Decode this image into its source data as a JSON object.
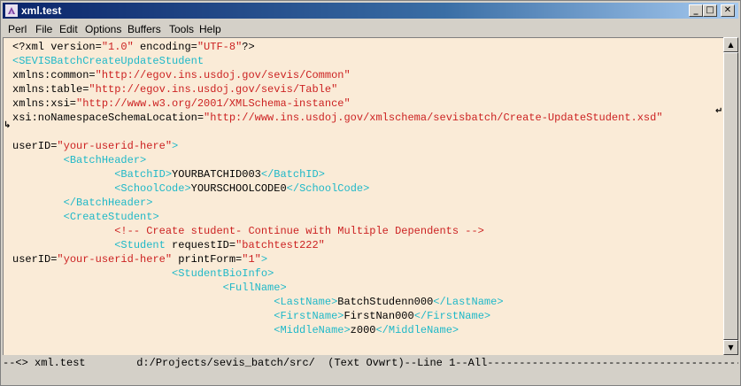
{
  "window": {
    "title": "xml.test",
    "minimize_glyph": "_",
    "maximize_glyph": "□",
    "close_glyph": "✕"
  },
  "menu": [
    "Perl",
    "File",
    "Edit",
    "Options",
    "Buffers",
    "Tools",
    "Help"
  ],
  "editor": {
    "background": "#faebd7",
    "tag_color": "#1fb8c8",
    "string_color": "#cc2222",
    "lines": [
      [
        "<?xml version=",
        "\"1.0\"",
        " encoding=",
        "\"UTF-8\"",
        "?>"
      ],
      [
        "<SEVISBatchCreateUpdateStudent"
      ],
      [
        "xmlns:common=",
        "\"http://egov.ins.usdoj.gov/sevis/Common\""
      ],
      [
        "xmlns:table=",
        "\"http://egov.ins.usdoj.gov/sevis/Table\""
      ],
      [
        "xmlns:xsi=",
        "\"http://www.w3.org/2001/XMLSchema-instance\""
      ],
      [
        "xsi:noNamespaceSchemaLocation=",
        "\"http://www.ins.usdoj.gov/xmlschema/sevisbatch/Create-UpdateStudent.xsd\""
      ],
      [
        ""
      ],
      [
        "userID=",
        "\"your-userid-here\"",
        ">"
      ],
      [
        "        ",
        "<",
        "BatchHeader",
        ">"
      ],
      [
        "                ",
        "<",
        "BatchID",
        ">",
        "YOURBATCHID003",
        "</",
        "BatchID",
        ">"
      ],
      [
        "                ",
        "<",
        "SchoolCode",
        ">",
        "YOURSCHOOLCODE0",
        "</",
        "SchoolCode",
        ">"
      ],
      [
        "        ",
        "</",
        "BatchHeader",
        ">"
      ],
      [
        "        ",
        "<",
        "CreateStudent",
        ">"
      ],
      [
        "                ",
        "<!-- Create student- Continue with Multiple Dependents -->"
      ],
      [
        "                ",
        "<",
        "Student",
        " requestID=",
        "\"batchtest222\""
      ],
      [
        "userID=",
        "\"your-userid-here\"",
        " printForm=",
        "\"1\"",
        ">"
      ],
      [
        "                         ",
        "<",
        "StudentBioInfo",
        ">"
      ],
      [
        "                                 ",
        "<",
        "FullName",
        ">"
      ],
      [
        "                                         ",
        "<",
        "LastName",
        ">",
        "BatchStudenn000",
        "</",
        "LastName",
        ">"
      ],
      [
        "                                         ",
        "<",
        "FirstName",
        ">",
        "FirstNan000",
        "</",
        "FirstName",
        ">"
      ],
      [
        "                                         ",
        "<",
        "MiddleName",
        ">",
        "z000",
        "</",
        "MiddleName",
        ">"
      ]
    ]
  },
  "modeline": "--<> xml.test        d:/Projects/sevis_batch/src/  (Text Ovwrt)--Line 1--All----------------------------------------"
}
